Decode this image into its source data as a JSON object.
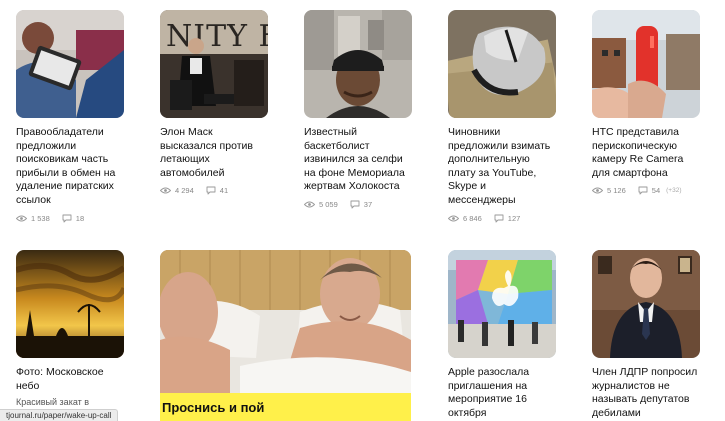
{
  "articles": [
    {
      "title": "Правообладатели предложили поисковикам часть прибыли в обмен на удаление пиратских ссылок",
      "views": "1 538",
      "comments": "18",
      "image": "person-with-laptop"
    },
    {
      "title": "Элон Маск высказался против летающих автомобилей",
      "views": "4 294",
      "comments": "41",
      "image": "speaker-on-stage"
    },
    {
      "title": "Известный баскетболист извинился за селфи на фоне Мемориала жертвам Холокоста",
      "views": "5 059",
      "comments": "37",
      "image": "selfie-at-memorial"
    },
    {
      "title": "Чиновники предложили взимать дополнительную плату за YouTube, Skype и мессенджеры",
      "views": "6 846",
      "comments": "127",
      "image": "mouse-on-banknotes"
    },
    {
      "title": "HTC представила перископическую камеру Re Camera для смартфона",
      "views": "5 126",
      "comments": "54",
      "comments_extra": "(+32)",
      "image": "hand-holding-red-camera"
    }
  ],
  "row2": {
    "photo": {
      "title": "Фото: Московское небо",
      "subtitle": "Красивый закат в столице в снимках из instagram",
      "image": "sunset-sky"
    },
    "wide": {
      "headline": "Проснись и пой",
      "image": "two-men-in-bed"
    },
    "apple": {
      "title": "Apple разослала приглашения на мероприятие 16 октября",
      "image": "colorful-apple-store"
    },
    "ldpr": {
      "title": "Член ЛДПР попросил журналистов не называть депутатов дебилами",
      "image": "man-in-suit"
    }
  },
  "status_url": "tjournal.ru/paper/wake-up-call",
  "icons": {
    "views": "eye-icon",
    "comments": "comment-icon"
  },
  "colors": {
    "headline_band": "#fff04a",
    "stats_text": "#888888"
  }
}
